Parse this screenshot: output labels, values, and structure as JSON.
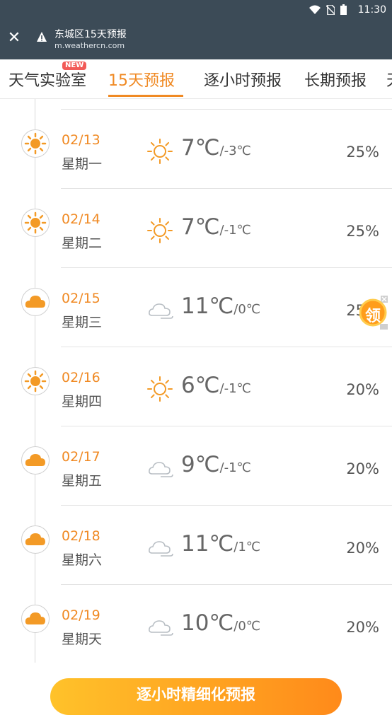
{
  "status_bar": {
    "time": "11:30"
  },
  "app_bar": {
    "title": "东城区15天预报",
    "url": "m.weathercn.com"
  },
  "tabs": [
    {
      "label": "天气实验室",
      "badge": "NEW"
    },
    {
      "label": "15天预报",
      "active": true
    },
    {
      "label": "逐小时预报"
    },
    {
      "label": "长期预报"
    },
    {
      "label": "天"
    }
  ],
  "forecast": [
    {
      "date": "02/13",
      "weekday": "星期一",
      "weather": "sunny-icon",
      "high": "7℃",
      "low": "/-3℃",
      "precip": "25%"
    },
    {
      "date": "02/14",
      "weekday": "星期二",
      "weather": "sunny-icon",
      "high": "7℃",
      "low": "/-1℃",
      "precip": "25%"
    },
    {
      "date": "02/15",
      "weekday": "星期三",
      "weather": "cloudy-icon",
      "high": "11℃",
      "low": "/0℃",
      "precip": "25%"
    },
    {
      "date": "02/16",
      "weekday": "星期四",
      "weather": "sunny-icon",
      "high": "6℃",
      "low": "/-1℃",
      "precip": "20%"
    },
    {
      "date": "02/17",
      "weekday": "星期五",
      "weather": "cloudy-icon",
      "high": "9℃",
      "low": "/-1℃",
      "precip": "20%"
    },
    {
      "date": "02/18",
      "weekday": "星期六",
      "weather": "cloudy-icon",
      "high": "11℃",
      "low": "/1℃",
      "precip": "20%"
    },
    {
      "date": "02/19",
      "weekday": "星期天",
      "weather": "cloudy-icon",
      "high": "10℃",
      "low": "/0℃",
      "precip": "20%"
    }
  ],
  "floating_widget": {
    "label": "领"
  },
  "cta": {
    "label": "逐小时精细化预报"
  },
  "colors": {
    "accent": "#f08a24",
    "header_bg": "#3c4b57"
  }
}
